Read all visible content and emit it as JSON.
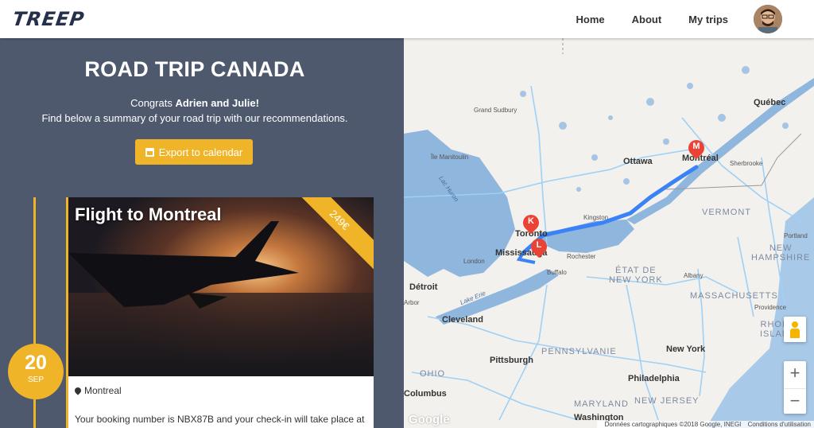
{
  "nav": {
    "logo": "TREEP",
    "links": [
      "Home",
      "About",
      "My trips"
    ]
  },
  "trip": {
    "title": "ROAD TRIP CANADA",
    "congrats_prefix": "Congrats ",
    "congrats_names": "Adrien and Julie!",
    "summary": "Find below a summary of your road trip with our recommendations.",
    "export_label": "Export to calendar"
  },
  "card": {
    "title": "Flight to Montreal",
    "price": "249€",
    "location": "Montreal",
    "booking_text": "Your booking number is NBX87B and your check-in will take place at"
  },
  "date": {
    "day": "20",
    "month": "SEP"
  },
  "map": {
    "labels": {
      "quebec": "Québec",
      "grand_sudbury": "Grand\nSudbury",
      "ile_manitoulin": "Île Manitoulin",
      "ottawa": "Ottawa",
      "montreal": "Montréal",
      "sherbrooke": "Sherbrooke",
      "lac_huron": "Lac Huron",
      "kingston": "Kingston",
      "vermont": "VERMONT",
      "toronto": "Toronto",
      "mississauga": "Mississauga",
      "portland": "Portland",
      "london": "London",
      "rochester": "Rochester",
      "new_hampshire": "NEW\nHAMPSHIRE",
      "etat_ny": "ÉTAT DE\nNEW YORK",
      "buffalo": "Buffalo",
      "detroit": "Détroit",
      "albany": "Albany",
      "arbor": "Arbor",
      "massachusetts": "MASSACHUSETTS",
      "lake_erie": "Lake Erie",
      "cleveland": "Cleveland",
      "providence": "Providence",
      "rhode": "RHODE\nISLAND",
      "pennsylvania": "PENNSYLVANIE",
      "pittsburgh": "Pittsburgh",
      "new_york": "New York",
      "ohio": "OHIO",
      "philadelphia": "Philadelphia",
      "columbus": "Columbus",
      "maryland": "MARYLAND",
      "new_jersey": "NEW JERSEY",
      "washington": "Washington"
    },
    "markers": [
      "M",
      "K",
      "L"
    ],
    "zoom_in": "+",
    "zoom_out": "−",
    "google": "Google",
    "attribution": "Données cartographiques ©2018 Google, INEGI",
    "terms": "Conditions d'utilisation"
  }
}
